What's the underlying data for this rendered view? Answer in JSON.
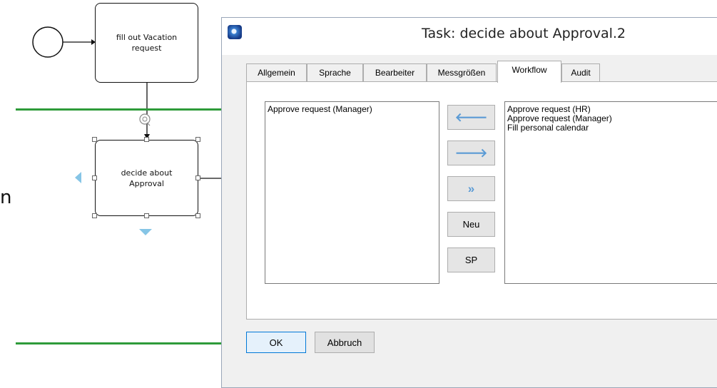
{
  "diagram": {
    "task1_label": "fill out Vacation\nrequest",
    "task2_label": "decide about\nApproval",
    "partial_text": "n"
  },
  "dialog": {
    "title": "Task: decide about Approval.2",
    "tabs": [
      "Allgemein",
      "Sprache",
      "Bearbeiter",
      "Messgrößen",
      "Workflow",
      "Audit"
    ],
    "active_tab": "Workflow",
    "left_list": [
      "Approve request (Manager)"
    ],
    "right_list": [
      "Approve request (HR)",
      "Approve request (Manager)",
      "Fill personal calendar"
    ],
    "buttons": {
      "move_left": "🡐",
      "move_right": "🡒",
      "move_all": "»",
      "new": "Neu",
      "sp": "SP"
    },
    "ok": "OK",
    "cancel": "Abbruch"
  },
  "colors": {
    "lane_line": "#2e9b3a",
    "selection_arrow": "#86c5e6",
    "arrow_button_glyph": "#5b9bd5"
  }
}
